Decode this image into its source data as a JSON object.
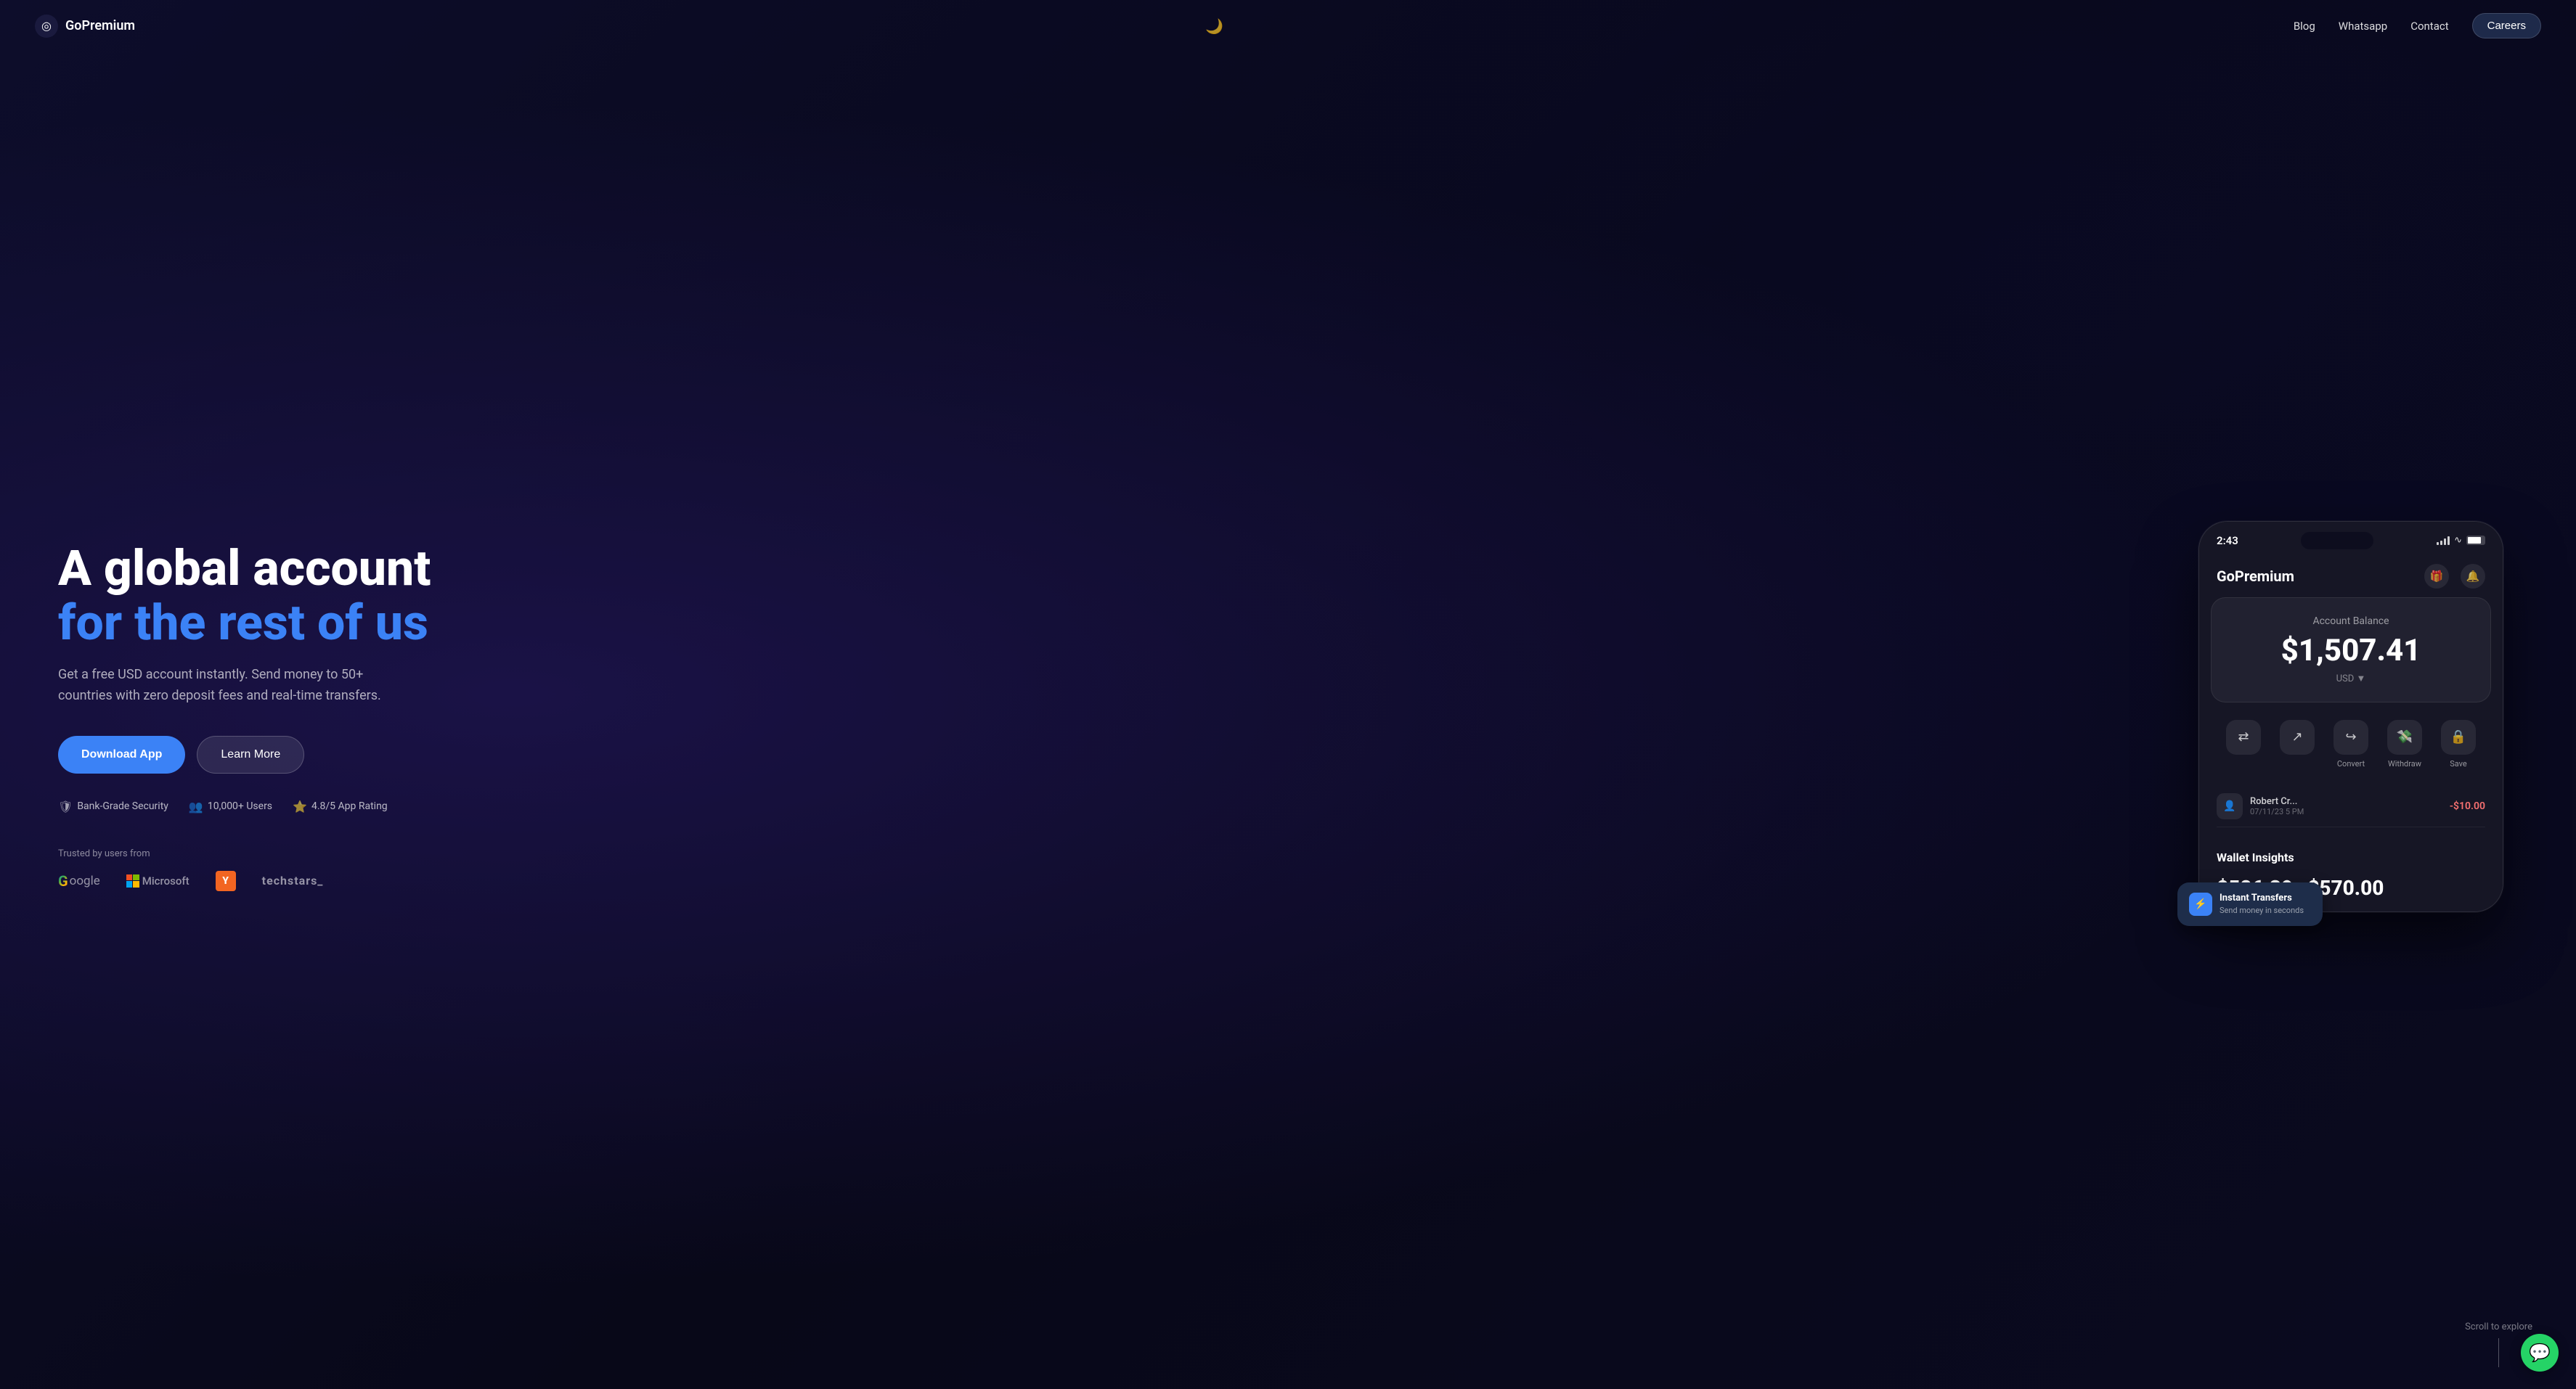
{
  "nav": {
    "logo_icon": "◎",
    "logo_text": "GoPremium",
    "theme_icon": "🌙",
    "links": [
      "Blog",
      "Whatsapp",
      "Contact"
    ],
    "cta": "Careers"
  },
  "hero": {
    "title_line1": "A global account",
    "title_line2": "for the rest of us",
    "subtitle": "Get a free USD account instantly. Send money to 50+ countries with zero deposit fees and real-time transfers.",
    "btn_download": "Download App",
    "btn_learn": "Learn More",
    "badges": [
      {
        "icon": "🛡",
        "text": "Bank-Grade Security"
      },
      {
        "icon": "👥",
        "text": "10,000+ Users"
      },
      {
        "icon": "⭐",
        "text": "4.8/5 App Rating"
      }
    ],
    "trusted_label": "Trusted by users from",
    "brands": [
      "Google",
      "Microsoft",
      "Y",
      "techstars_"
    ]
  },
  "phone": {
    "time": "2:43",
    "app_name": "GoPremium",
    "balance_label": "Account Balance",
    "balance_amount": "$1,507.41",
    "currency": "USD ▼",
    "actions": [
      {
        "icon": "⇄",
        "label": ""
      },
      {
        "icon": "↗",
        "label": ""
      },
      {
        "icon": "↪",
        "label": "Convert"
      },
      {
        "icon": "💸",
        "label": "Withdraw"
      },
      {
        "icon": "🔒",
        "label": "Save"
      }
    ],
    "transaction_name": "Robert Cr...",
    "transaction_time": "07/11/23 5 PM",
    "transaction_amount": "-$10.00",
    "wallet_insights_title": "Wallet Insights",
    "insight_1": "$586.39",
    "insight_2": "$570.00"
  },
  "tooltip": {
    "title": "Instant Transfers",
    "subtitle": "Send money in seconds"
  },
  "scroll_text": "Scroll to explore",
  "whatsapp_icon": "💬"
}
